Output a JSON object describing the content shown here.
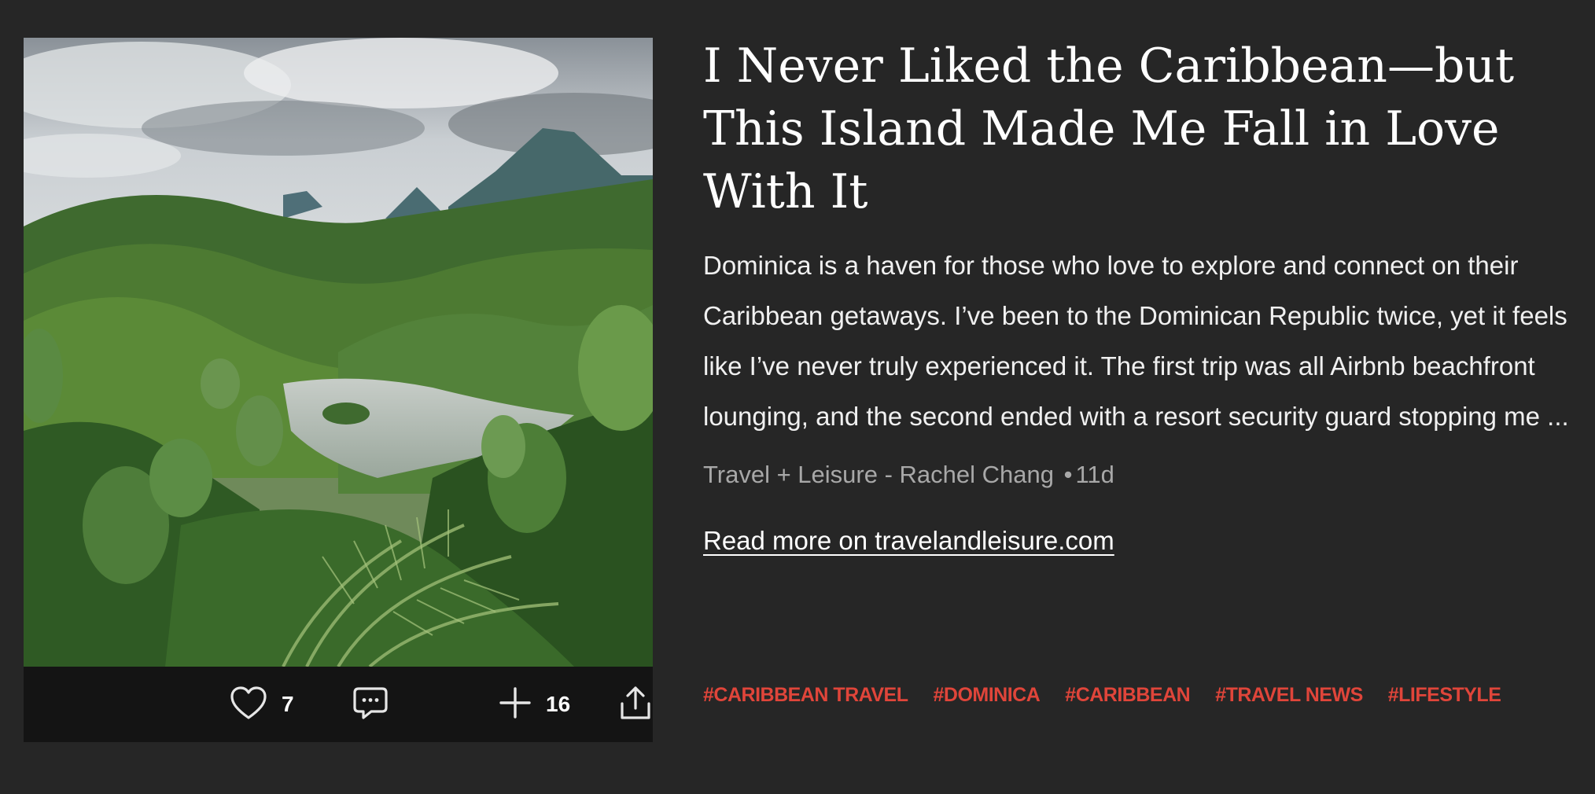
{
  "article": {
    "headline": "I Never Liked the Caribbean—but This Island Made Me Fall in Love With It",
    "summary": "Dominica is a haven for those who love to explore and connect on their Caribbean getaways. I’ve been to the Dominican Republic twice, yet it feels like I’ve never truly experienced it. The first trip was all Airbnb beachfront lounging, and the second ended with a resort security guard stopping me ...",
    "source": "Travel + Leisure - Rachel Chang",
    "separator": "•",
    "age": "11d",
    "read_more": "Read more on travelandleisure.com"
  },
  "actions": {
    "like_count": "7",
    "add_count": "16",
    "icons": [
      "heart-icon",
      "comment-icon",
      "plus-icon",
      "share-icon"
    ]
  },
  "tags": [
    "#CARIBBEAN TRAVEL",
    "#DOMINICA",
    "#CARIBBEAN",
    "#TRAVEL NEWS",
    "#LIFESTYLE"
  ],
  "colors": {
    "background": "#262626",
    "action_bar": "#141414",
    "tag": "#e0453a",
    "byline": "#a8a8a8"
  }
}
